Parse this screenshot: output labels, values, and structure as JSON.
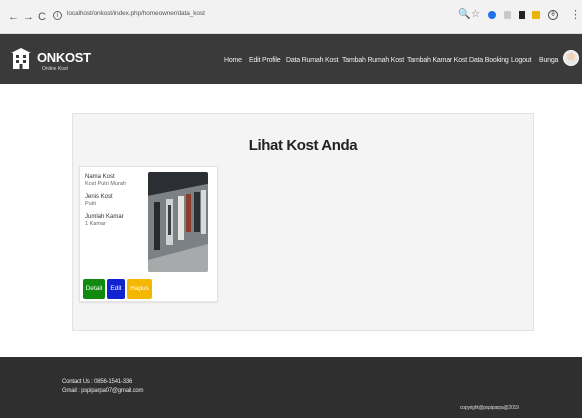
{
  "browser": {
    "back": "←",
    "forward": "→",
    "reload": "C",
    "info": "i",
    "url": "localhost/onkost/index.php/homeowner/data_kost",
    "zoom": "🔍",
    "star": "☆",
    "profile": "θ",
    "menu": "⋮"
  },
  "navbar": {
    "brand": "ONKOST",
    "tagline": "Online Kost",
    "links": [
      "Home",
      "Edit Profile",
      "Data Rumah Kost",
      "Tambah Rumah Kost",
      "Tambah Kamar Kost",
      "Data Booking",
      "Logout",
      "Bunga"
    ]
  },
  "main": {
    "title": "Lihat Kost Anda",
    "kost": {
      "name_label": "Nama Kost",
      "name_value": "Kost Putri Murah",
      "type_label": "Jenis Kost",
      "type_value": "Putri",
      "rooms_label": "Jumlah Kamar",
      "rooms_value": "1 Kamar",
      "buttons": {
        "detail": "Detail",
        "edit": "Edit",
        "delete": "Hapus"
      }
    }
  },
  "footer": {
    "contact_us": "Contact Us : 0856-1541-336",
    "email": "Gmail : pspiparpa07@gmail.com",
    "copyright": "copyright@pspiparpa@2019"
  },
  "colors": {
    "navbar": "#3a3a3a",
    "footer": "#2f2f2f",
    "detail_button": "#0f8a0f",
    "edit_button": "#1122d0",
    "delete_button": "#f6b700"
  }
}
